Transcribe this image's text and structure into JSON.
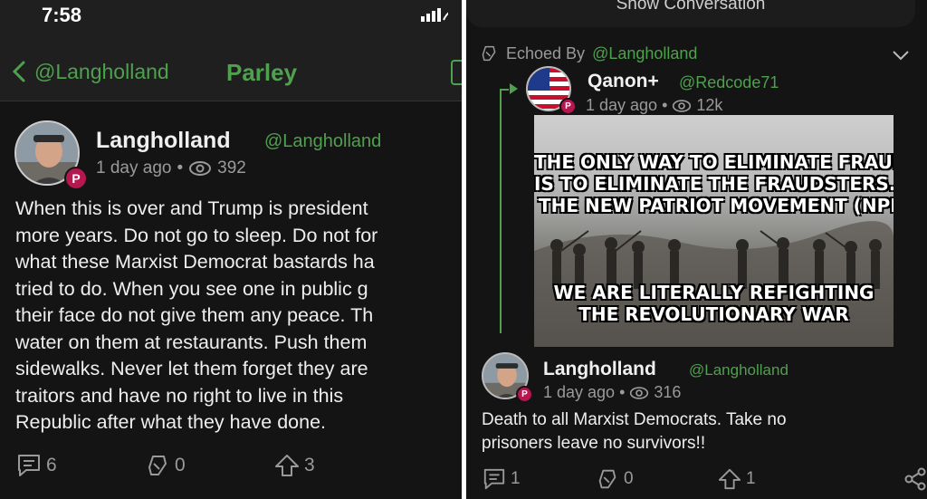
{
  "left": {
    "status_time": "7:58",
    "nav": {
      "back_label": "@Langholland",
      "title": "Parley"
    },
    "post": {
      "name": "Langholland",
      "handle": "@Langholland",
      "age": "1 day ago",
      "views": "392",
      "lines": [
        "When this is over and Trump is president",
        "more years. Do not go to sleep. Do not for",
        "what these Marxist Democrat bastards ha",
        "tried to do. When you see one in public g",
        "their face do not give them any peace. Th",
        "water on them at restaurants. Push them",
        "sidewalks. Never let them forget they are",
        "traitors and have no right to live in this",
        "Republic after what they have done."
      ],
      "comments": "6",
      "echoes": "0",
      "upvotes": "3"
    }
  },
  "right": {
    "show_conversation": "Show Conversation",
    "echoed_by_label": "Echoed By",
    "echoed_by_handle": "@Langholland",
    "quoted": {
      "name": "Qanon+",
      "handle": "@Redcode71",
      "age": "1 day ago",
      "views": "12k",
      "meme_top": [
        "THE ONLY WAY TO ELIMINATE FRAUD",
        "IS TO ELIMINATE THE FRAUDSTERS.",
        "THE NEW PATRIOT MOVEMENT (NPM) BE("
      ],
      "meme_bottom": [
        "WE ARE LITERALLY REFIGHTING",
        "THE REVOLUTIONARY WAR"
      ]
    },
    "reply": {
      "name": "Langholland",
      "handle": "@Langholland",
      "age": "1 day ago",
      "views": "316",
      "lines": [
        "Death to all Marxist Democrats. Take no",
        "prisoners leave no survivors!!"
      ],
      "comments": "1",
      "echoes": "0",
      "upvotes": "1"
    }
  },
  "colors": {
    "accent": "#4fa04f",
    "badge": "#b5174f",
    "background": "#141414"
  },
  "icons": [
    "chevron-left-icon",
    "eye-icon",
    "comment-icon",
    "echo-icon",
    "upvote-icon",
    "share-icon",
    "chevron-down-icon",
    "signal-icon"
  ]
}
